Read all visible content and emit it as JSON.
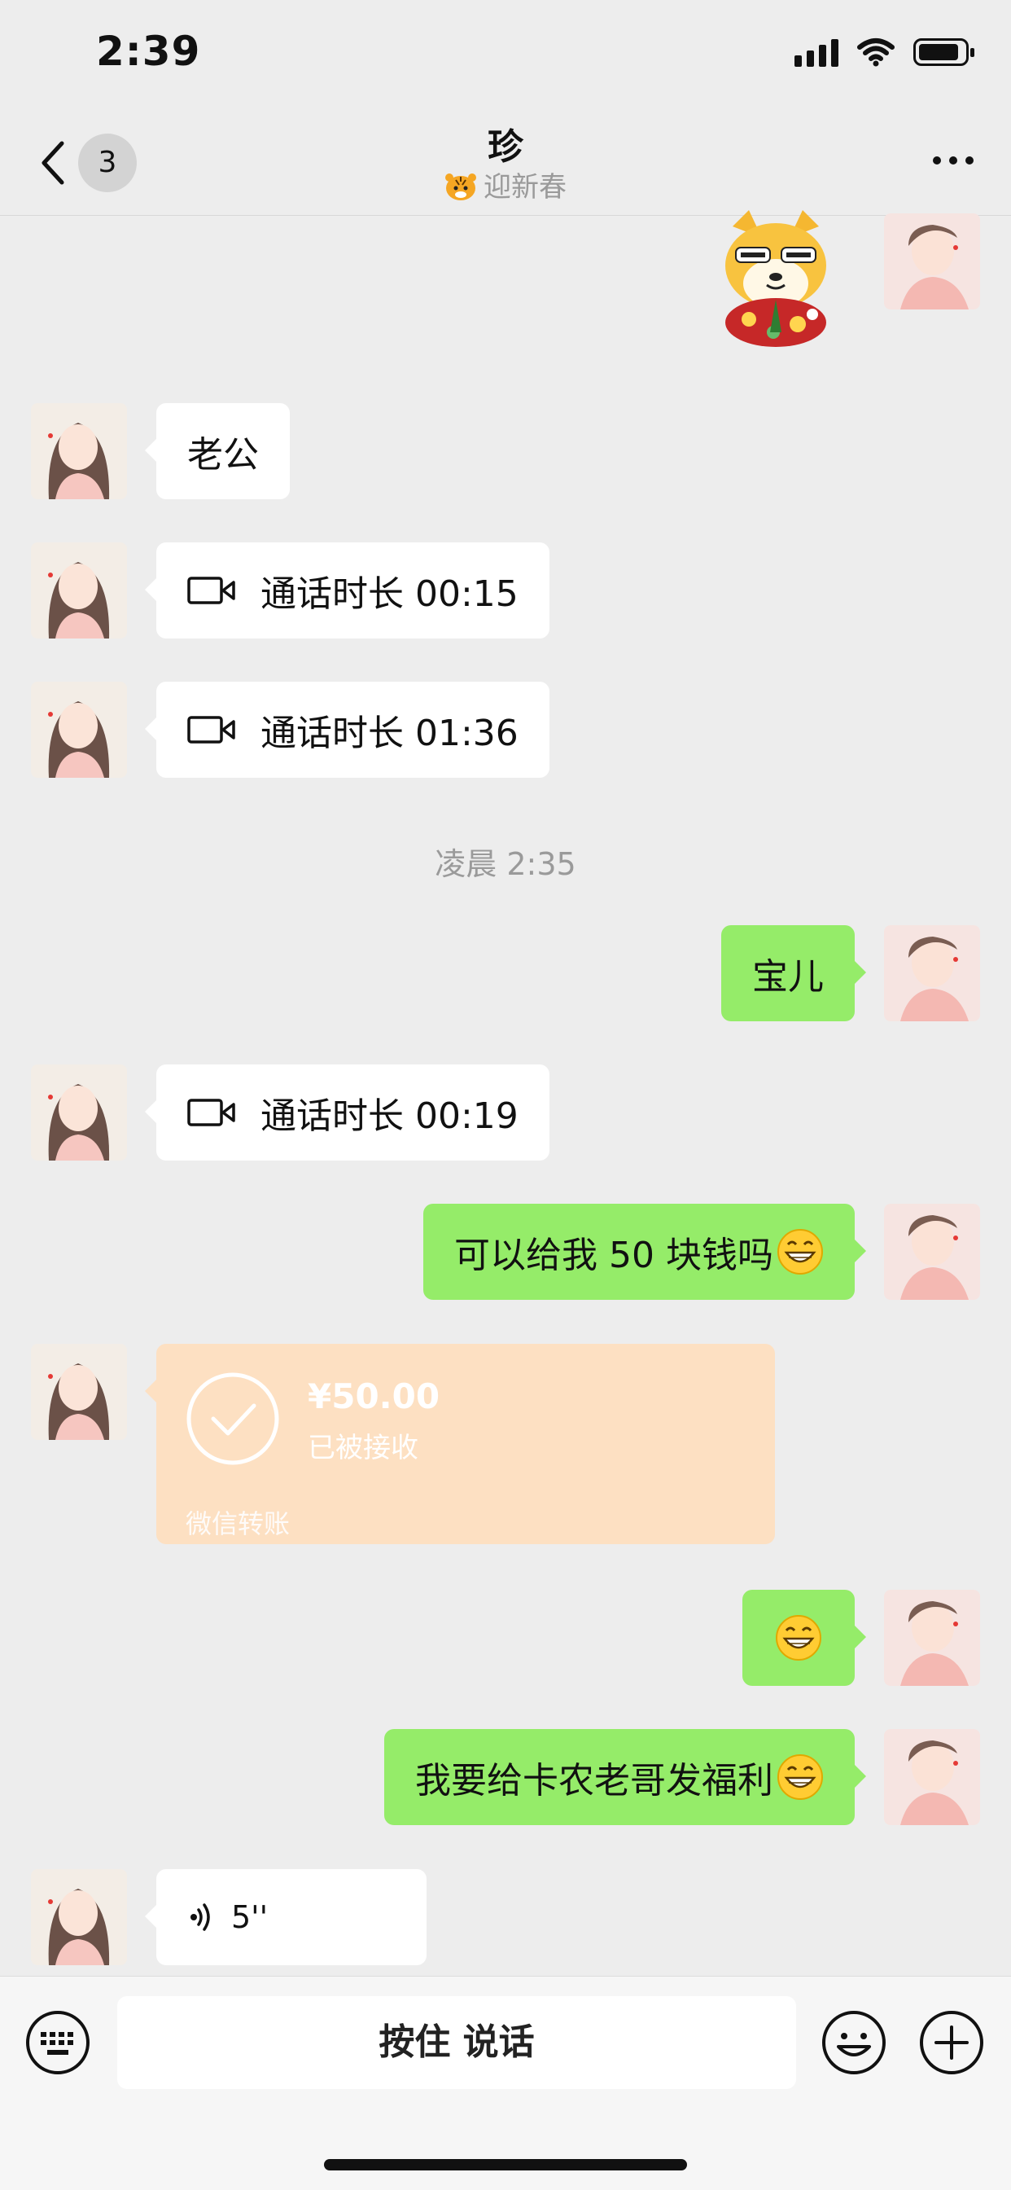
{
  "status_bar": {
    "time": "2:39"
  },
  "header": {
    "title": "珍",
    "subtitle": "迎新春",
    "unread_badge": "3"
  },
  "messages": {
    "m1": {
      "text": "老公"
    },
    "m2": {
      "text": "通话时长 00:15"
    },
    "m3": {
      "text": "通话时长 01:36"
    },
    "divider": "凌晨 2:35",
    "m4": {
      "text": "宝儿"
    },
    "m5": {
      "text": "通话时长 00:19"
    },
    "m6": {
      "text": "可以给我 50 块钱吗"
    },
    "transfer": {
      "amount": "¥50.00",
      "status": "已被接收",
      "label": "微信转账"
    },
    "m8": {
      "text": ""
    },
    "m9": {
      "text": "我要给卡农老哥发福利"
    },
    "voice": {
      "duration": "5''"
    }
  },
  "input_bar": {
    "hold_to_talk": "按住 说话"
  },
  "colors": {
    "background": "#ededed",
    "outgoing_bubble": "#95ec69",
    "incoming_bubble": "#ffffff",
    "transfer_card": "#fde0c2"
  },
  "icons": [
    "back-icon",
    "more-icon",
    "video-call-icon",
    "grin-emoji-icon",
    "check-icon",
    "voice-icon",
    "keyboard-icon",
    "emoji-icon",
    "plus-icon"
  ]
}
